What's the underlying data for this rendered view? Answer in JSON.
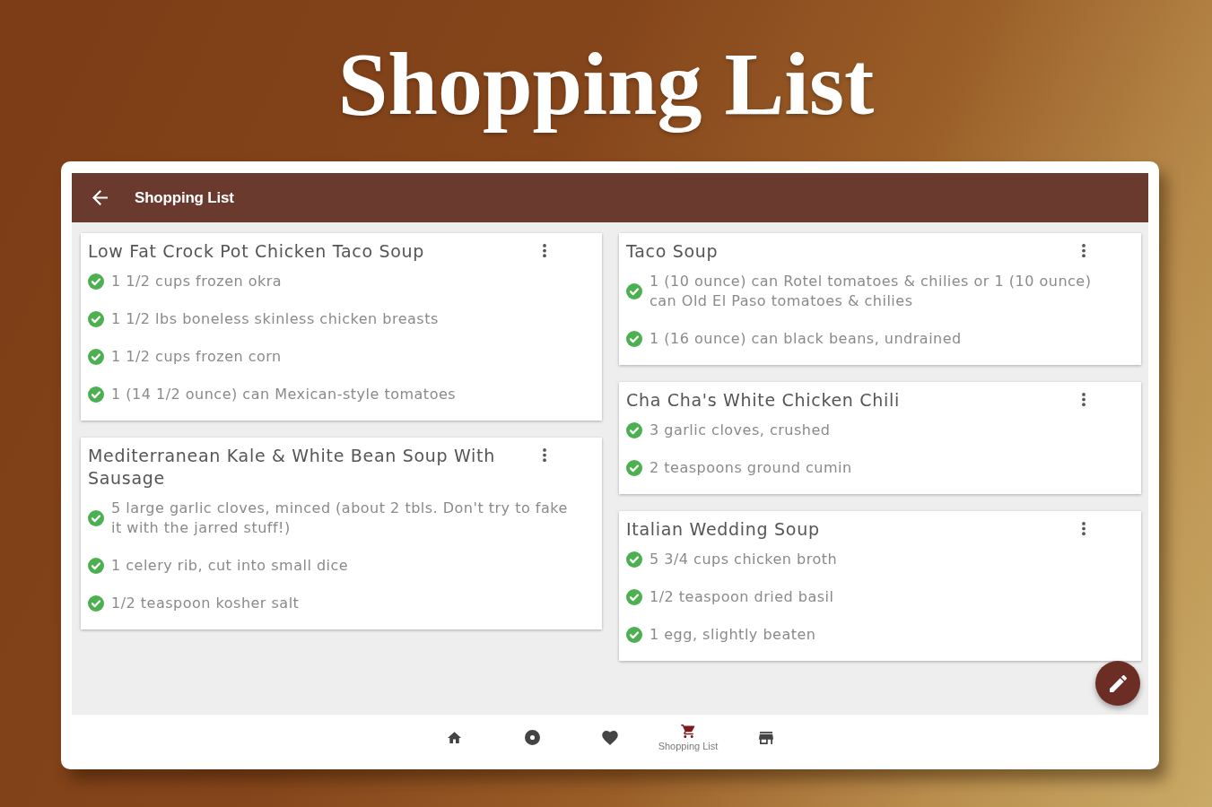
{
  "page_title": "Shopping List",
  "app_bar": {
    "title": "Shopping List"
  },
  "columns": [
    {
      "cards": [
        {
          "title": "Low Fat Crock Pot Chicken Taco Soup",
          "items": [
            {
              "text": "1 1/2 cups frozen okra",
              "checked": true
            },
            {
              "text": "1 1/2 lbs boneless skinless chicken breasts",
              "checked": true
            },
            {
              "text": "1 1/2 cups frozen corn",
              "checked": true
            },
            {
              "text": "1 (14 1/2 ounce) can Mexican-style tomatoes",
              "checked": true
            }
          ]
        },
        {
          "title": "Mediterranean Kale & White Bean Soup With Sausage",
          "items": [
            {
              "text": "5 large garlic cloves, minced (about 2 tbls. Don't try to fake it with the jarred stuff!)",
              "checked": true
            },
            {
              "text": "1 celery rib, cut into small dice",
              "checked": true
            },
            {
              "text": "1/2 teaspoon kosher salt",
              "checked": true
            }
          ]
        }
      ]
    },
    {
      "cards": [
        {
          "title": "Taco Soup",
          "items": [
            {
              "text": "1 (10 ounce) can Rotel tomatoes & chilies or 1 (10 ounce) can Old El Paso tomatoes & chilies",
              "checked": true
            },
            {
              "text": "1 (16 ounce) can black beans, undrained",
              "checked": true
            }
          ]
        },
        {
          "title": "Cha Cha's White Chicken Chili",
          "items": [
            {
              "text": "3 garlic cloves, crushed",
              "checked": true
            },
            {
              "text": "2 teaspoons ground cumin",
              "checked": true
            }
          ]
        },
        {
          "title": "Italian Wedding Soup",
          "items": [
            {
              "text": "5 3/4 cups chicken broth",
              "checked": true
            },
            {
              "text": "1/2 teaspoon dried basil",
              "checked": true
            },
            {
              "text": "1 egg, slightly beaten",
              "checked": true
            }
          ]
        }
      ]
    }
  ],
  "bottom_nav": [
    {
      "selected": false
    },
    {
      "selected": false
    },
    {
      "selected": false
    },
    {
      "label": "Shopping List",
      "selected": true
    },
    {
      "selected": false
    }
  ]
}
